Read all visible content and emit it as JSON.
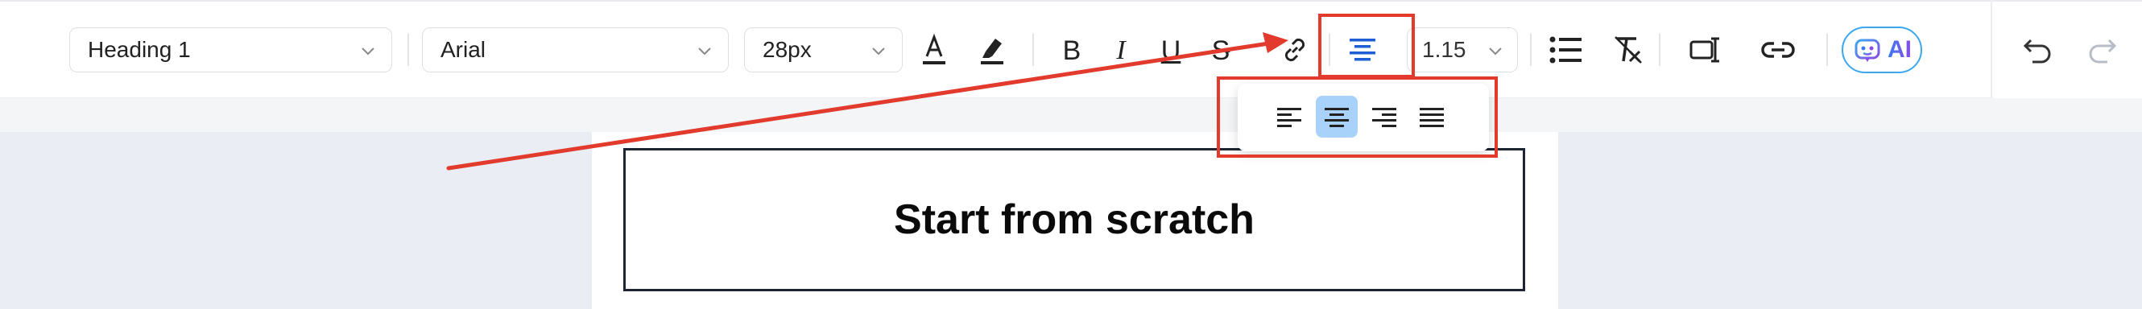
{
  "toolbar": {
    "style_select": {
      "value": "Heading 1"
    },
    "font_select": {
      "value": "Arial"
    },
    "size_select": {
      "value": "28px"
    },
    "format": {
      "bold": "B",
      "italic": "I",
      "underline": "U",
      "strike": "S"
    },
    "line_height": {
      "value": "1.15"
    },
    "ai_button": {
      "label": "AI"
    }
  },
  "align_popup": {
    "options": [
      "align-left",
      "align-center",
      "align-right",
      "align-justify"
    ],
    "selected": "align-center"
  },
  "document": {
    "heading": "Start from scratch"
  },
  "colors": {
    "accent": "#1f5fd6",
    "annotation": "#e23b2e",
    "active_option": "#a9d2fb",
    "canvas": "#eaedf4"
  }
}
